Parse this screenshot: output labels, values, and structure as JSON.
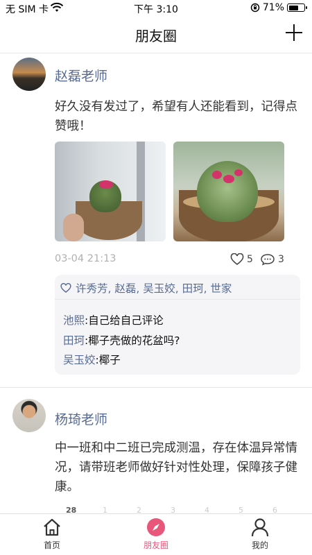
{
  "status_bar": {
    "carrier": "无 SIM 卡",
    "time": "下午 3:10",
    "battery": "71%",
    "battery_level": 0.71,
    "icons": [
      "wifi-icon",
      "rotation-lock-icon",
      "battery-icon"
    ]
  },
  "header": {
    "title": "朋友圈",
    "add_icon": "plus-icon"
  },
  "posts": [
    {
      "author": "赵磊老师",
      "text": "好久没有发过了，希望有人还能看到，记得点赞哦！",
      "images": [
        "cactus-photo-1",
        "cactus-photo-2"
      ],
      "time": "03-04 21:13",
      "like_count": "5",
      "comment_count": "3",
      "likes": "许秀芳, 赵磊, 吴玉姣, 田珂, 世家",
      "comments": [
        {
          "who": "池熙",
          "sep": ":",
          "text": "自己给自己评论"
        },
        {
          "who": "田珂",
          "sep": ":",
          "text": "椰子壳做的花盆吗?"
        },
        {
          "who": "吴玉姣",
          "sep": ":",
          "text": "椰子"
        }
      ]
    },
    {
      "author": "杨琦老师",
      "text": "中一班和中二班已完成测温，存在体温异常情况，请带班老师做好针对性处理，保障孩子健康。"
    }
  ],
  "date_strip": [
    "28",
    "1",
    "2",
    "3",
    "4",
    "5",
    "6"
  ],
  "tabbar": {
    "items": [
      {
        "label": "首页",
        "icon": "home-icon"
      },
      {
        "label": "朋友圈",
        "icon": "compass-icon",
        "active": true
      },
      {
        "label": "我的",
        "icon": "user-icon"
      }
    ]
  },
  "colors": {
    "link_blue": "#576b95",
    "accent_pink": "#e8577a"
  }
}
